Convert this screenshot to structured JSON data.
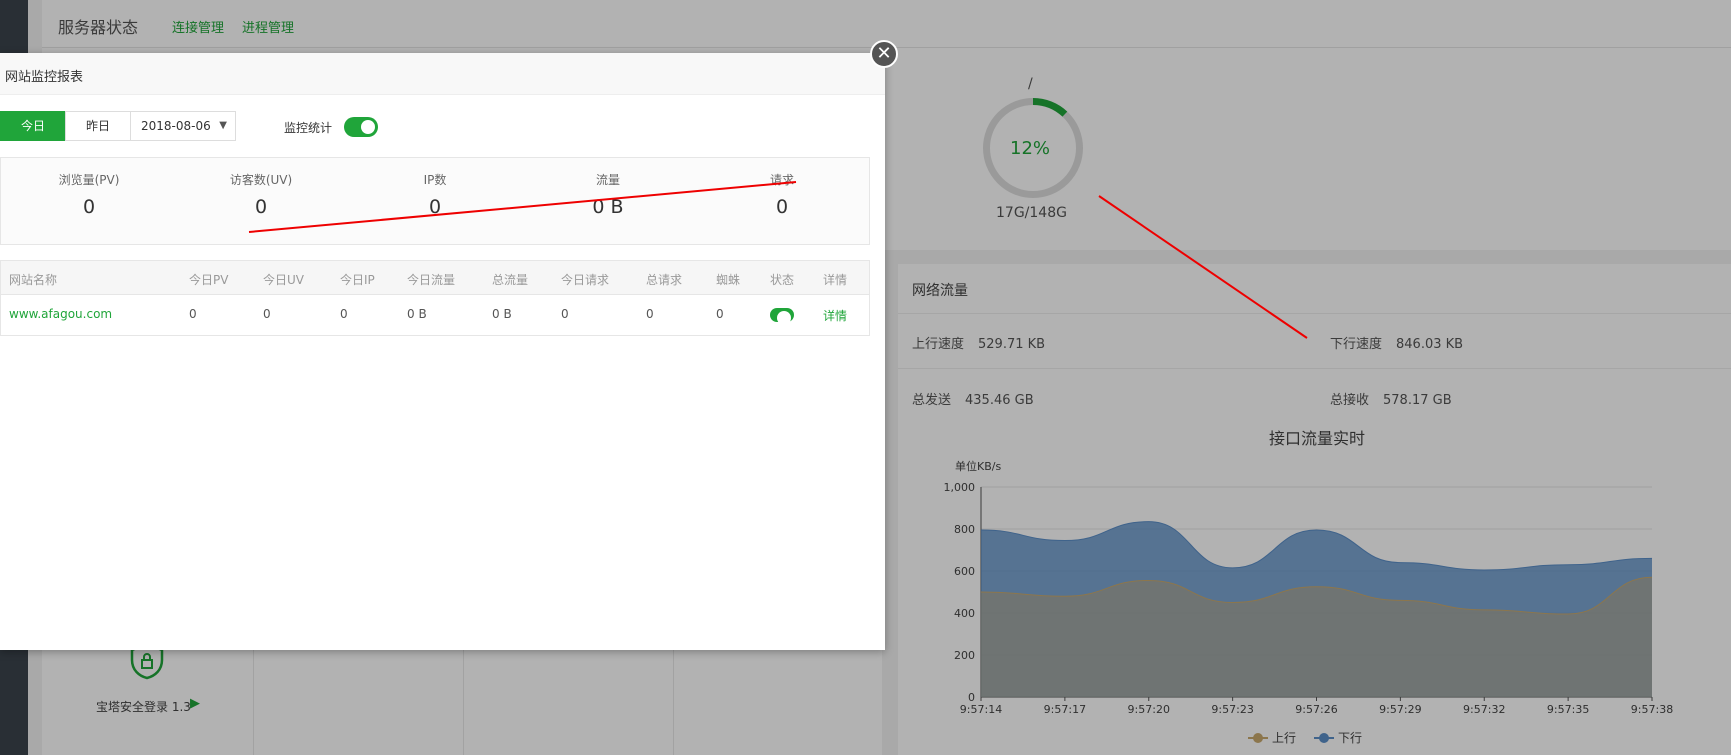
{
  "topbar": {
    "title": "服务器状态",
    "links": [
      "连接管理",
      "进程管理"
    ]
  },
  "disk": {
    "mount": "/",
    "percent_label": "12%",
    "percent": 12,
    "usage": "17G/148G"
  },
  "net": {
    "title": "网络流量",
    "up_label": "上行速度",
    "up_value": "529.71 KB",
    "down_label": "下行速度",
    "down_value": "846.03 KB",
    "sent_label": "总发送",
    "sent_value": "435.46 GB",
    "recv_label": "总接收",
    "recv_value": "578.17 GB"
  },
  "security_label": "宝塔安全登录 1.3",
  "dialog": {
    "title": "网站监控报表",
    "today": "今日",
    "yesterday": "昨日",
    "date": "2018-08-06",
    "monitor_label": "监控统计",
    "stats": [
      {
        "label": "浏览量(PV)",
        "value": "0"
      },
      {
        "label": "访客数(UV)",
        "value": "0"
      },
      {
        "label": "IP数",
        "value": "0"
      },
      {
        "label": "流量",
        "value": "0 B"
      },
      {
        "label": "请求",
        "value": "0"
      }
    ],
    "columns": [
      "网站名称",
      "今日PV",
      "今日UV",
      "今日IP",
      "今日流量",
      "总流量",
      "今日请求",
      "总请求",
      "蜘蛛",
      "状态",
      "详情"
    ],
    "rows": [
      {
        "site": "www.afagou.com",
        "pv": "0",
        "uv": "0",
        "ip": "0",
        "traffic": "0 B",
        "total": "0 B",
        "req": "0",
        "total_req": "0",
        "spider": "0",
        "detail": "详情"
      }
    ]
  },
  "chart_data": {
    "type": "area",
    "title": "接口流量实时",
    "ylabel": "单位KB/s",
    "x": [
      "9:57:14",
      "9:57:17",
      "9:57:20",
      "9:57:23",
      "9:57:26",
      "9:57:29",
      "9:57:32",
      "9:57:35",
      "9:57:38"
    ],
    "ylim": [
      0,
      1000
    ],
    "yticks": [
      "0",
      "200",
      "400",
      "600",
      "800",
      "1,000"
    ],
    "series": [
      {
        "name": "上行",
        "values": [
          500,
          480,
          555,
          450,
          525,
          460,
          415,
          395,
          570
        ],
        "color": "#c9a96e"
      },
      {
        "name": "下行",
        "values": [
          795,
          745,
          835,
          615,
          795,
          640,
          605,
          630,
          660
        ],
        "color": "#5b8ec7"
      }
    ],
    "stacked": false,
    "legend": "bottom"
  }
}
